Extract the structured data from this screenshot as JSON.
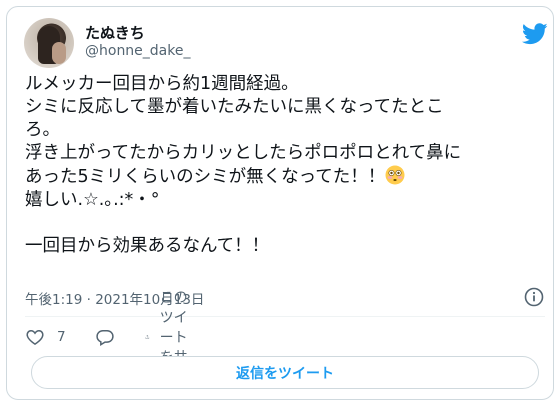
{
  "user": {
    "display_name": "たぬきち",
    "handle": "@honne_dake_"
  },
  "tweet": {
    "lines": [
      "ルメッカー回目から約1週間経過。",
      "シミに反応して墨が着いたみたいに黒くなってたとこ",
      "ろ。",
      "浮き上がってたからカリッとしたらポロポロとれて鼻に",
      "あった5ミリくらいのシミが無くなってた！！",
      "嬉しい.☆.｡.:*・°",
      "",
      "一回目から効果あるなんて！！"
    ],
    "emoji_icon": "flushed-face-emoji"
  },
  "meta": {
    "timestamp": "午後1:19 · 2021年10月13日"
  },
  "actions": {
    "like_count": "7",
    "share_label": "このツイートを共有"
  },
  "reply_button_label": "返信をツイート",
  "colors": {
    "twitter_blue": "#1d9bf0",
    "muted_text": "#536471",
    "border": "#cfd9de"
  }
}
